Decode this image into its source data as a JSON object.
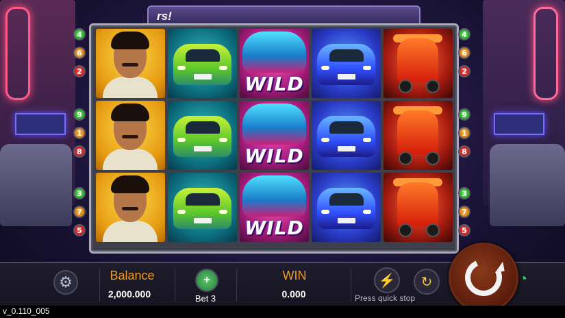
{
  "header": {
    "title_fragment": "rs!"
  },
  "reels": [
    [
      "man",
      "taxi-yellow",
      "wild",
      "taxi-blue",
      "tuk-tuk"
    ],
    [
      "man",
      "taxi-yellow",
      "wild",
      "taxi-blue",
      "tuk-tuk"
    ],
    [
      "man",
      "taxi-yellow",
      "wild",
      "taxi-blue",
      "tuk-tuk"
    ]
  ],
  "wild_label": "WILD",
  "line_markers": {
    "left": [
      "4",
      "6",
      "2",
      "9",
      "1",
      "8",
      "3",
      "7",
      "5"
    ],
    "right": [
      "4",
      "6",
      "2",
      "9",
      "1",
      "8",
      "3",
      "7",
      "5"
    ],
    "colors": [
      "green",
      "orange",
      "red",
      "green",
      "orange",
      "red",
      "green",
      "orange",
      "red"
    ]
  },
  "bottom_bar": {
    "balance_label": "Balance",
    "balance_value": "2,000.000",
    "bet_label": "Bet 3",
    "win_label": "WIN",
    "win_value": "0.000",
    "quick_stop_label": "Press quick stop"
  },
  "icons": {
    "settings": "gear-icon",
    "bet": "coins-plus-icon",
    "turbo": "lightning-icon",
    "autoplay": "autoplay-icon",
    "spin": "spin-arrow-icon",
    "connection": "wifi-icon"
  },
  "colors": {
    "accent_orange": "#f29c28",
    "wifi_green": "#3ad26a",
    "spin_brown": "#5a1c0c"
  },
  "version": "v_0.110_005"
}
